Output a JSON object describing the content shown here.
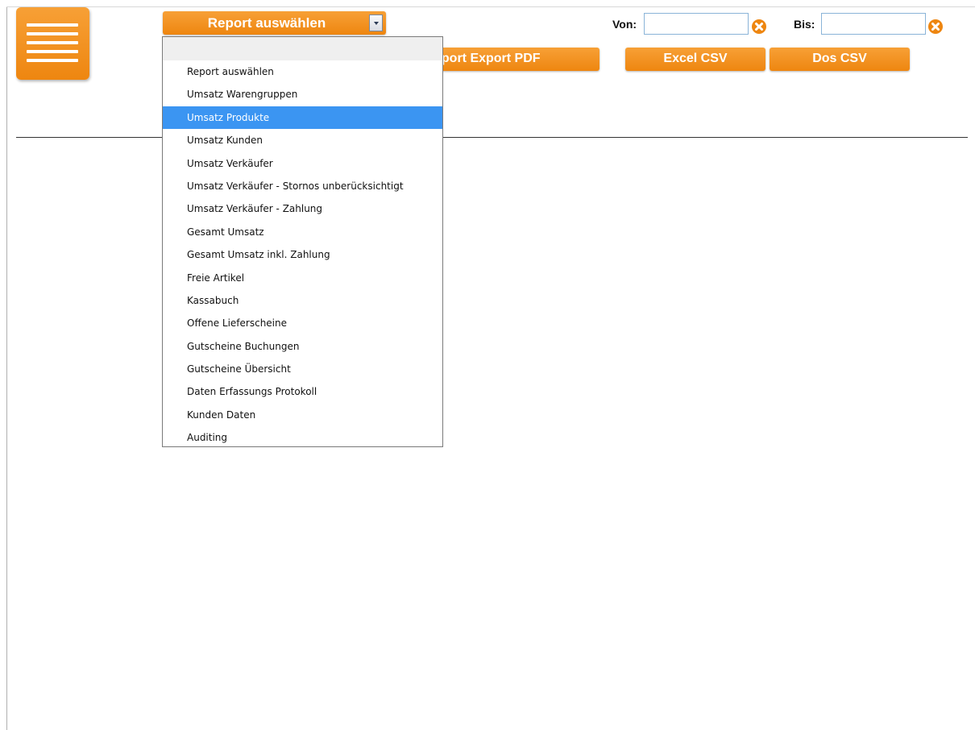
{
  "menu_button": {
    "icon": "hamburger-icon"
  },
  "report_select": {
    "label": "Report auswählen",
    "icon": "chevron-down-icon"
  },
  "date_range": {
    "from_label": "Von:",
    "from_value": "",
    "to_label": "Bis:",
    "to_value": "",
    "clear_icon": "clear-icon"
  },
  "toolbar": {
    "pdf_label": "Report Export PDF",
    "excel_label": "Excel CSV",
    "dos_label": "Dos CSV"
  },
  "dropdown": {
    "selected": "Umsatz Produkte",
    "options": [
      "Report auswählen",
      "Umsatz Warengruppen",
      "Umsatz Produkte",
      "Umsatz Kunden",
      "Umsatz Verkäufer",
      "Umsatz Verkäufer - Stornos unberücksichtigt",
      "Umsatz Verkäufer - Zahlung",
      "Gesamt Umsatz",
      "Gesamt Umsatz inkl. Zahlung",
      "Freie Artikel",
      "Kassabuch",
      "Offene Lieferscheine",
      "Gutscheine Buchungen",
      "Gutscheine Übersicht",
      "Daten Erfassungs Protokoll",
      "Kunden Daten",
      "Auditing"
    ]
  },
  "colors": {
    "accent": "#f39018",
    "highlight": "#3b95f2",
    "clear_icon": "#ee8610"
  }
}
